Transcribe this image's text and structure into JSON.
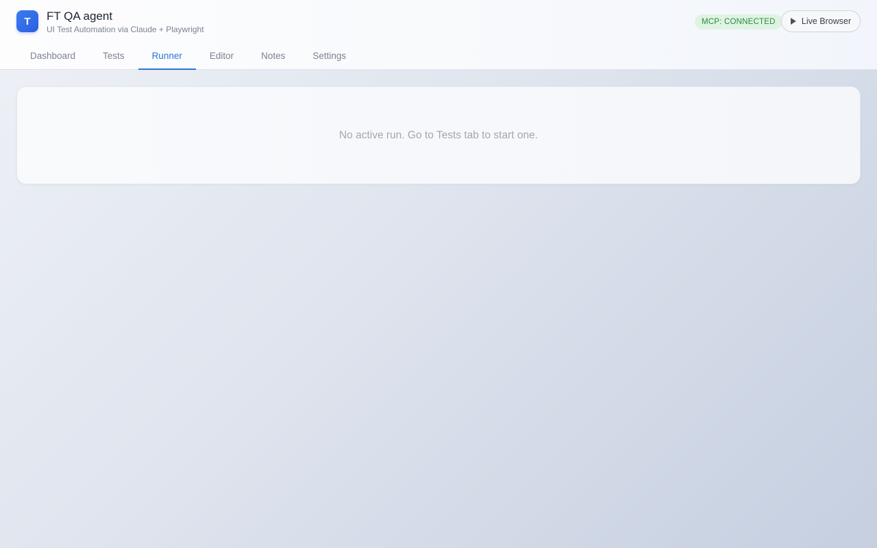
{
  "app": {
    "logo_letter": "T",
    "title": "FT QA agent",
    "subtitle": "UI Test Automation via Claude + Playwright"
  },
  "header": {
    "mcp_status": "MCP: CONNECTED",
    "mcp_status_color": "#2a8a3e",
    "live_browser_label": "Live Browser",
    "live_browser_icon": "play-icon"
  },
  "tabs": [
    {
      "label": "Dashboard",
      "active": false
    },
    {
      "label": "Tests",
      "active": false
    },
    {
      "label": "Runner",
      "active": true
    },
    {
      "label": "Editor",
      "active": false
    },
    {
      "label": "Notes",
      "active": false
    },
    {
      "label": "Settings",
      "active": false
    }
  ],
  "runner": {
    "empty_message": "No active run. Go to Tests tab to start one."
  },
  "colors": {
    "accent": "#2a74d6",
    "logo": "#2a5fe0"
  }
}
